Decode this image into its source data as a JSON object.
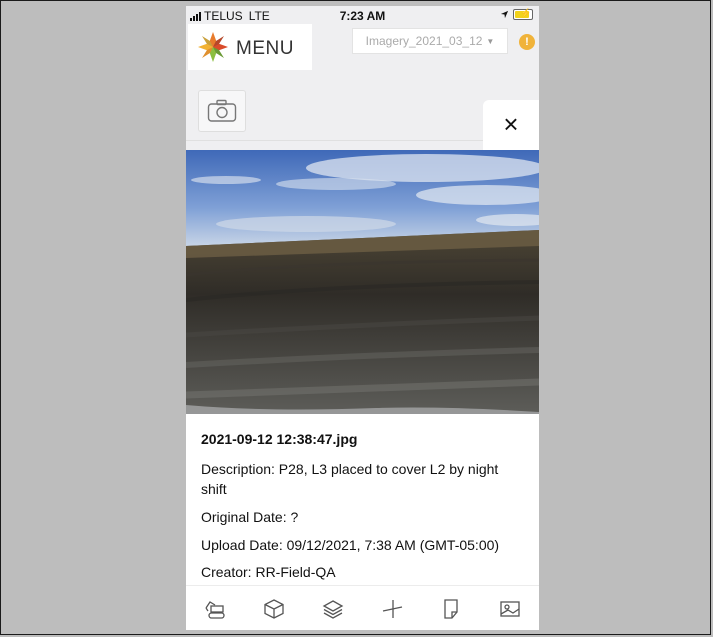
{
  "status_bar": {
    "carrier": "TELUS",
    "network": "LTE",
    "time": "7:23 AM"
  },
  "header": {
    "menu_label": "MENU",
    "imagery_select": {
      "value": "Imagery_2021_03_12"
    },
    "alert_badge": "!"
  },
  "photo_details": {
    "close_label": "×",
    "filename": "2021-09-12 12:38:47.jpg",
    "description": "Description: P28, L3 placed to cover L2 by night shift",
    "original_date": "Original Date: ?",
    "upload_date": "Upload Date: 09/12/2021, 7:38 AM (GMT-05:00)",
    "creator": "Creator: RR-Field-QA"
  },
  "toolbar": {
    "icons": [
      "excavator-icon",
      "cube-icon",
      "layers-icon",
      "measure-icon",
      "document-icon",
      "image-icon"
    ]
  },
  "colors": {
    "alert": "#f0b33a",
    "battery": "#f2d21a",
    "panel_bg": "#efeff1"
  }
}
